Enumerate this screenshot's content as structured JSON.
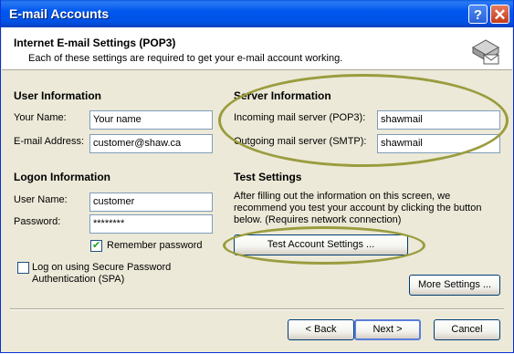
{
  "window": {
    "title": "E-mail Accounts"
  },
  "titlebar": {
    "help_label": "?",
    "close_label": "✕"
  },
  "header": {
    "title": "Internet E-mail Settings (POP3)",
    "subtitle": "Each of these settings are required to get your e-mail account working.",
    "icon": "mail-server-icon"
  },
  "user_info": {
    "heading": "User Information",
    "name_label": "Your Name:",
    "name_value": "Your name",
    "email_label": "E-mail Address:",
    "email_value": "customer@shaw.ca"
  },
  "server_info": {
    "heading": "Server Information",
    "incoming_label": "Incoming mail server (POP3):",
    "incoming_value": "shawmail",
    "outgoing_label": "Outgoing mail server (SMTP):",
    "outgoing_value": "shawmail"
  },
  "logon_info": {
    "heading": "Logon Information",
    "username_label": "User Name:",
    "username_value": "customer",
    "password_label": "Password:",
    "password_value": "********",
    "remember_label": "Remember password",
    "remember_checked": true,
    "spa_label_line1": "Log on using Secure Password",
    "spa_label_line2": "Authentication (SPA)",
    "spa_checked": false
  },
  "test_settings": {
    "heading": "Test Settings",
    "desc_line1": "After filling out the information on this screen, we",
    "desc_line2": "recommend you test your account by clicking the button",
    "desc_line3": "below. (Requires network connection)",
    "button_label": "Test Account Settings ..."
  },
  "more_settings_label": "More Settings ...",
  "footer": {
    "back_label": "< Back",
    "next_label": "Next >",
    "cancel_label": "Cancel"
  },
  "colors": {
    "titlebar": "#0058ee",
    "highlight_ellipse": "#9a9c3e",
    "dialog_bg": "#ece9d8"
  }
}
